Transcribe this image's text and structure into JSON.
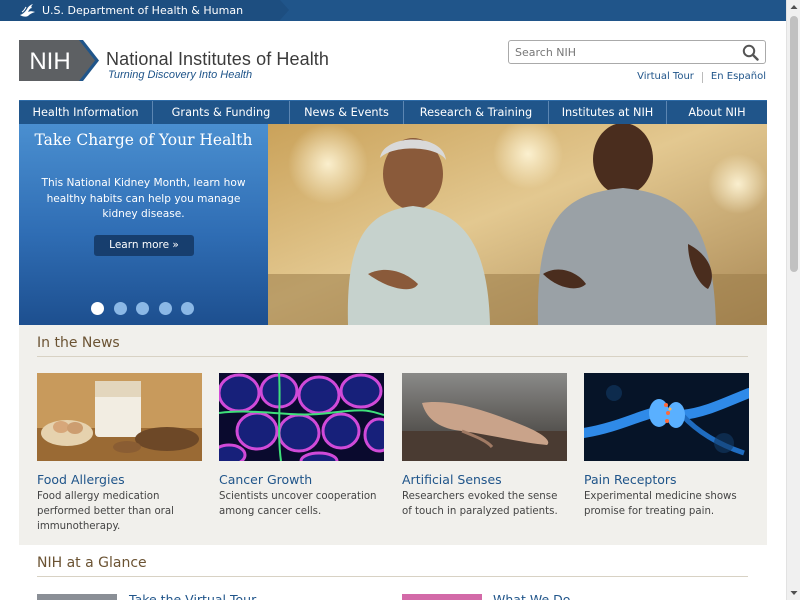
{
  "hhs": {
    "label": "U.S. Department of Health & Human Services"
  },
  "header": {
    "logo_abbr": "NIH",
    "title": "National Institutes of Health",
    "tagline": "Turning Discovery Into Health",
    "search_placeholder": "Search NIH",
    "links": [
      "Virtual Tour",
      "En Español"
    ]
  },
  "nav": {
    "items": [
      "Health Information",
      "Grants & Funding",
      "News & Events",
      "Research & Training",
      "Institutes at NIH",
      "About NIH"
    ]
  },
  "hero": {
    "title": "Take Charge of Your Health",
    "text": "This National Kidney Month, learn how healthy habits can help you manage kidney disease.",
    "button": "Learn more »",
    "slide_count": 5,
    "active_slide": 1
  },
  "news": {
    "title": "In the News",
    "cards": [
      {
        "title": "Food Allergies",
        "desc": "Food allergy medication performed better than oral immunotherapy.",
        "image": "milk-bread-nuts-photo"
      },
      {
        "title": "Cancer Growth",
        "desc": "Scientists uncover cooperation among cancer cells.",
        "image": "cancer-cells-micrograph"
      },
      {
        "title": "Artificial Senses",
        "desc": "Researchers evoked the sense of touch in paralyzed patients.",
        "image": "hand-touch-photo"
      },
      {
        "title": "Pain Receptors",
        "desc": "Experimental medicine shows promise for treating pain.",
        "image": "neuron-synapse-illustration"
      }
    ]
  },
  "glance": {
    "title": "NIH at a Glance",
    "links": [
      "Take the Virtual Tour",
      "What We Do"
    ]
  },
  "colors": {
    "brand_blue": "#20558a",
    "hero_blue": "#2f6db4",
    "section_brown": "#6b5333",
    "content_bg": "#f1f0ec"
  }
}
